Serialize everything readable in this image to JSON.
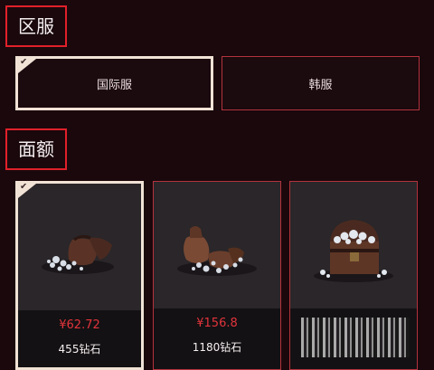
{
  "sections": {
    "server_title": "区服",
    "denomination_title": "面额"
  },
  "servers": [
    {
      "label": "国际服",
      "selected": true
    },
    {
      "label": "韩服",
      "selected": false
    }
  ],
  "check_glyph": "✔",
  "cards": [
    {
      "price": "¥62.72",
      "amount": "455钻石",
      "selected": true,
      "icon": "diamond-bag-icon"
    },
    {
      "price": "¥156.8",
      "amount": "1180钻石",
      "selected": false,
      "icon": "diamond-bags-icon"
    },
    {
      "price": "",
      "amount": "",
      "selected": false,
      "icon": "treasure-chest-icon"
    }
  ],
  "colors": {
    "accent_red": "#e0202a",
    "border_red": "#b2333d",
    "selected_border": "#f1e2d6",
    "price": "#e2343c"
  }
}
